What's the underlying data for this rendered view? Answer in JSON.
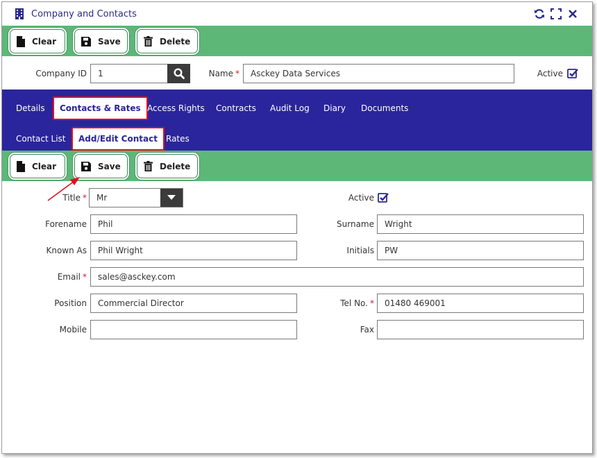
{
  "window": {
    "title": "Company and Contacts"
  },
  "toolbar_top": {
    "clear_label": "Clear",
    "save_label": "Save",
    "delete_label": "Delete"
  },
  "company": {
    "id_label": "Company ID",
    "id_value": "1",
    "name_label": "Name",
    "name_value": "Asckey Data Services",
    "active_label": "Active",
    "active_checked": true
  },
  "tabs": [
    "Details",
    "Contacts & Rates",
    "Access Rights",
    "Contracts",
    "Audit Log",
    "Diary",
    "Documents"
  ],
  "subtabs": [
    "Contact List",
    "Add/Edit Contact",
    "Rates"
  ],
  "toolbar_sub": {
    "clear_label": "Clear",
    "save_label": "Save",
    "delete_label": "Delete"
  },
  "contact": {
    "title_label": "Title",
    "title_value": "Mr",
    "active_label": "Active",
    "active_checked": true,
    "forename_label": "Forename",
    "forename_value": "Phil",
    "surname_label": "Surname",
    "surname_value": "Wright",
    "known_as_label": "Known As",
    "known_as_value": "Phil Wright",
    "initials_label": "Initials",
    "initials_value": "PW",
    "email_label": "Email",
    "email_value": "sales@asckey.com",
    "position_label": "Position",
    "position_value": "Commercial Director",
    "tel_label": "Tel No.",
    "tel_value": "01480 469001",
    "mobile_label": "Mobile",
    "mobile_value": "",
    "fax_label": "Fax",
    "fax_value": ""
  },
  "colors": {
    "brand_blue": "#2a259c",
    "toolbar_green": "#5db878",
    "highlight_red": "#e0101c"
  }
}
